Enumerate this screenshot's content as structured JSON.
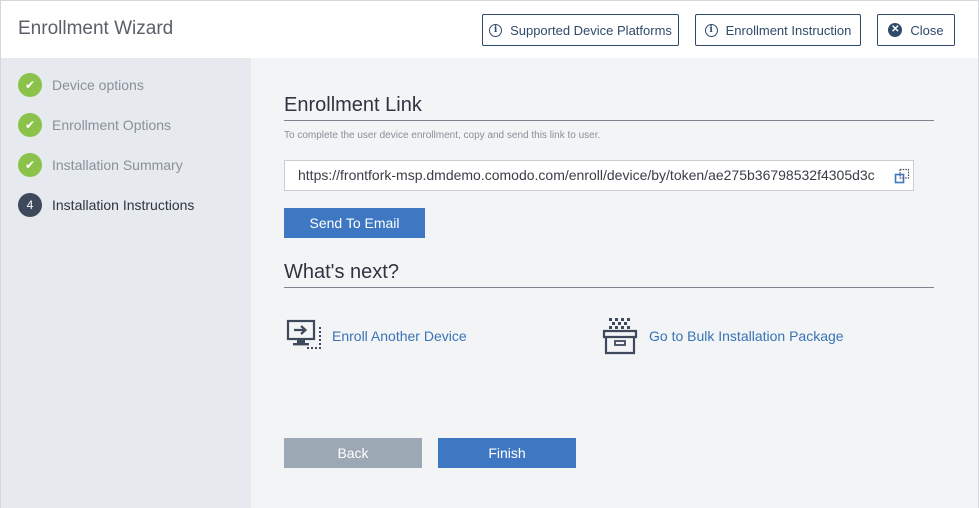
{
  "header": {
    "title": "Enrollment Wizard",
    "supported_platforms_label": "Supported Device Platforms",
    "enrollment_instruction_label": "Enrollment Instruction",
    "close_label": "Close"
  },
  "sidebar": {
    "steps": [
      {
        "label": "Device options",
        "state": "done"
      },
      {
        "label": "Enrollment Options",
        "state": "done"
      },
      {
        "label": "Installation Summary",
        "state": "done"
      },
      {
        "label": "Installation Instructions",
        "state": "current",
        "number": "4"
      }
    ]
  },
  "main": {
    "enrollment_link": {
      "title": "Enrollment Link",
      "hint": "To complete the user device enrollment, copy and send this link to user.",
      "url": "https://frontfork-msp.dmdemo.comodo.com/enroll/device/by/token/ae275b36798532f4305d3c",
      "send_to_email_label": "Send To Email"
    },
    "whats_next": {
      "title": "What's next?",
      "enroll_another_label": "Enroll Another Device",
      "bulk_package_label": "Go to Bulk Installation Package"
    }
  },
  "footer": {
    "back_label": "Back",
    "finish_label": "Finish"
  },
  "colors": {
    "accent": "#3e78c2",
    "success": "#8bc34a",
    "dark": "#2f4a6b",
    "disabled": "#9ca9b5"
  },
  "icons": {
    "info": "info-icon",
    "close": "close-circle-icon",
    "done": "checkmark-icon",
    "copy": "copy-icon",
    "enroll_device": "monitor-arrow-icon",
    "bulk_package": "package-box-icon"
  }
}
